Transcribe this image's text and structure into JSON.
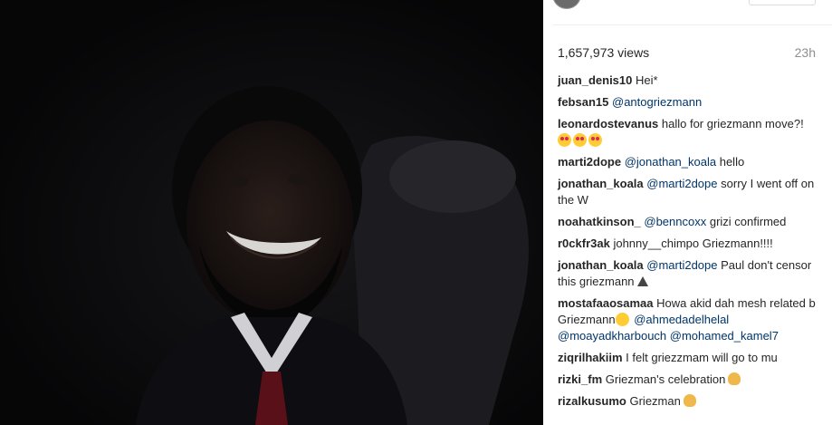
{
  "post": {
    "views": "1,657,973 views",
    "time_ago": "23h"
  },
  "comments": [
    {
      "user": "juan_denis10",
      "text": "Hei*"
    },
    {
      "user": "febsan15",
      "mention": "@antogriezmann"
    },
    {
      "user": "leonardostevanus",
      "text": "hallo for griezmann move?!",
      "emoji": [
        "smiling-face-with-heart-eyes",
        "smiling-face-with-heart-eyes",
        "smiling-face-with-heart-eyes"
      ]
    },
    {
      "user": "marti2dope",
      "mention": "@jonathan_koala",
      "text": "hello"
    },
    {
      "user": "jonathan_koala",
      "mention": "@marti2dope",
      "text": "sorry I went off on the W"
    },
    {
      "user": "noahatkinson_",
      "mention": "@benncoxx",
      "text": "grizi confirmed"
    },
    {
      "user": "r0ckfr3ak",
      "text": "johnny__chimpo Griezmann!!!!"
    },
    {
      "user": "jonathan_koala",
      "mention": "@marti2dope",
      "text": "Paul don't censor this griezmann",
      "emoji": [
        "warning-sign"
      ]
    },
    {
      "user": "mostafaaosamaa",
      "text": "Howa akid dah mesh related b Griezmann",
      "emoji": [
        "thinking-face"
      ],
      "mentions": [
        "@ahmedadelhelal",
        "@moayadkharbouch",
        "@mohamed_kamel7"
      ]
    },
    {
      "user": "ziqrilhakiim",
      "text": "I felt griezzmam will go to mu"
    },
    {
      "user": "rizki_fm",
      "text": "Griezman's celebration",
      "emoji": [
        "clapping-hands"
      ]
    },
    {
      "user": "rizalkusumo",
      "text": "Griezman",
      "emoji": [
        "clapping-hands"
      ]
    }
  ]
}
